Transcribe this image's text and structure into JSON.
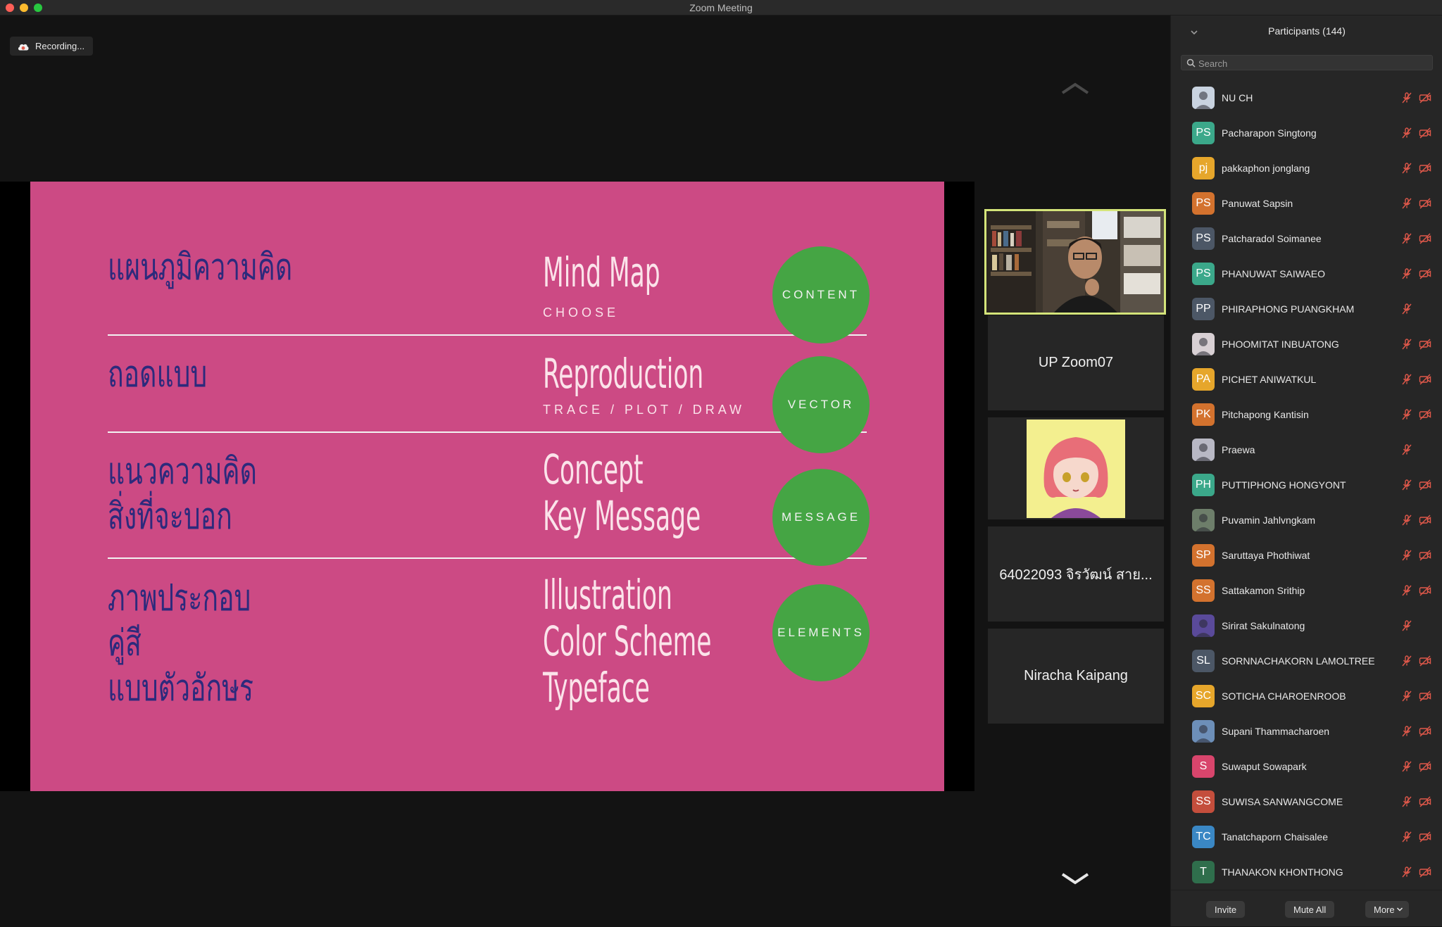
{
  "window": {
    "title": "Zoom Meeting"
  },
  "recording": {
    "label": "Recording..."
  },
  "slide": {
    "rows": [
      {
        "thai": [
          "แผนภูมิความคิด"
        ],
        "english": [
          "Mind Map"
        ],
        "sub": "CHOOSE",
        "circle": "CONTENT"
      },
      {
        "thai": [
          "ถอดแบบ"
        ],
        "english": [
          "Reproduction"
        ],
        "sub": "TRACE / PLOT / DRAW",
        "circle": "VECTOR"
      },
      {
        "thai": [
          "แนวความคิด",
          "สิ่งที่จะบอก"
        ],
        "english": [
          "Concept",
          "Key Message"
        ],
        "sub": "",
        "circle": "MESSAGE"
      },
      {
        "thai": [
          "ภาพประกอบ",
          "คู่สี",
          "แบบตัวอักษร"
        ],
        "english": [
          "Illustration",
          "Color Scheme",
          "Typeface"
        ],
        "sub": "",
        "circle": "ELEMENTS"
      }
    ]
  },
  "video_tiles": [
    {
      "name": "UP Zoom07"
    },
    {
      "name": "64022093 จิรวัฒน์ สาย..."
    },
    {
      "name": "Niracha Kaipang"
    }
  ],
  "participants": {
    "title": "Participants (144)",
    "search_placeholder": "Search",
    "list": [
      {
        "name": "NU CH",
        "initials": "",
        "color": "#c9d3e0",
        "photo": true,
        "video_off": true
      },
      {
        "name": "Pacharapon Singtong",
        "initials": "PS",
        "color": "#3ba88a",
        "video_off": true
      },
      {
        "name": "pakkaphon jonglang",
        "initials": "pj",
        "color": "#e6a62b",
        "video_off": true
      },
      {
        "name": "Panuwat Sapsin",
        "initials": "PS",
        "color": "#d3722e",
        "video_off": true
      },
      {
        "name": "Patcharadol Soimanee",
        "initials": "PS",
        "color": "#4c5766",
        "video_off": true
      },
      {
        "name": "PHANUWAT SAIWAEO",
        "initials": "PS",
        "color": "#3ba88a",
        "video_off": true
      },
      {
        "name": "PHIRAPHONG PUANGKHAM",
        "initials": "PP",
        "color": "#4c5766",
        "video_off": false
      },
      {
        "name": "PHOOMITAT INBUATONG",
        "initials": "",
        "color": "#d8d0d4",
        "photo": true,
        "video_off": true
      },
      {
        "name": "PICHET ANIWATKUL",
        "initials": "PA",
        "color": "#e6a62b",
        "video_off": true
      },
      {
        "name": "Pitchapong Kantisin",
        "initials": "PK",
        "color": "#d3722e",
        "video_off": true
      },
      {
        "name": "Praewa",
        "initials": "",
        "color": "#b8b8c4",
        "photo": true,
        "video_off": false
      },
      {
        "name": "PUTTIPHONG HONGYONT",
        "initials": "PH",
        "color": "#3ba88a",
        "video_off": true
      },
      {
        "name": "Puvamin Jahlvngkam",
        "initials": "",
        "color": "#6d7e6a",
        "photo": true,
        "video_off": true
      },
      {
        "name": "Saruttaya Phothiwat",
        "initials": "SP",
        "color": "#d3722e",
        "video_off": true
      },
      {
        "name": "Sattakamon Srithip",
        "initials": "SS",
        "color": "#d3722e",
        "video_off": true
      },
      {
        "name": "Sirirat Sakulnatong",
        "initials": "",
        "color": "#5a4a9a",
        "photo": true,
        "video_off": false
      },
      {
        "name": "SORNNACHAKORN LAMOLTREE",
        "initials": "SL",
        "color": "#4c5766",
        "video_off": true
      },
      {
        "name": "SOTICHA CHAROENROOB",
        "initials": "SC",
        "color": "#e6a62b",
        "video_off": true
      },
      {
        "name": "Supani Thammacharoen",
        "initials": "",
        "color": "#6d8fb8",
        "photo": true,
        "video_off": true
      },
      {
        "name": "Suwaput Sowapark",
        "initials": "S",
        "color": "#d8456c",
        "video_off": true
      },
      {
        "name": "SUWISA SANWANGCOME",
        "initials": "SS",
        "color": "#c44e3c",
        "video_off": true
      },
      {
        "name": "Tanatchaporn Chaisalee",
        "initials": "TC",
        "color": "#3a87c4",
        "video_off": true
      },
      {
        "name": "THANAKON KHONTHONG",
        "initials": "T",
        "color": "#2f6e4c",
        "video_off": true
      }
    ]
  },
  "footer": {
    "invite": "Invite",
    "mute_all": "Mute All",
    "more": "More"
  },
  "colors": {
    "slide_bg": "#cc4a84",
    "circle": "#45a544",
    "thai_text": "#2c2a7c",
    "active_speaker": "#d4e47a",
    "muted_icon": "#e0584a"
  }
}
